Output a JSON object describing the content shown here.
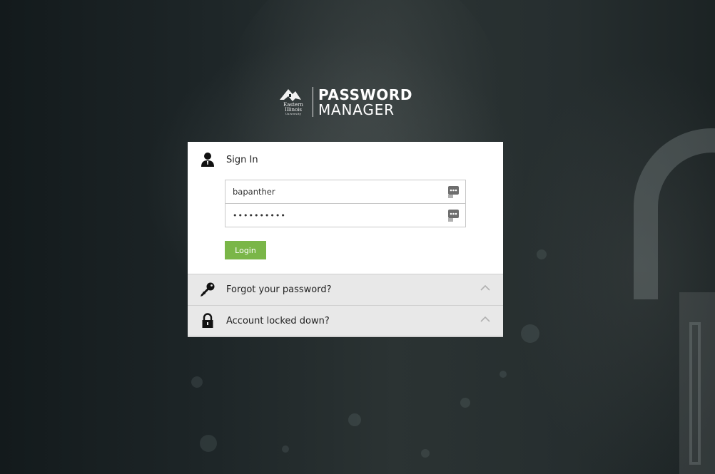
{
  "brand": {
    "university_line1": "Eastern",
    "university_line2": "Illinois",
    "university_line3": "University",
    "title_line1": "PASSWORD",
    "title_line2": "MANAGER"
  },
  "signin": {
    "title": "Sign In",
    "username_value": "bapanther",
    "password_value": "••••••••••",
    "login_label": "Login"
  },
  "accordion": {
    "forgot_label": "Forgot your password?",
    "locked_label": "Account locked down?"
  },
  "colors": {
    "login_button": "#7ab648",
    "panel_bg": "#ffffff",
    "accordion_bg": "#e8e8e8"
  },
  "icons": {
    "signin": "user-icon",
    "forgot": "key-icon",
    "locked": "padlock-icon",
    "field_addon": "password-manager-icon",
    "accordion_toggle": "chevron-up-icon"
  }
}
